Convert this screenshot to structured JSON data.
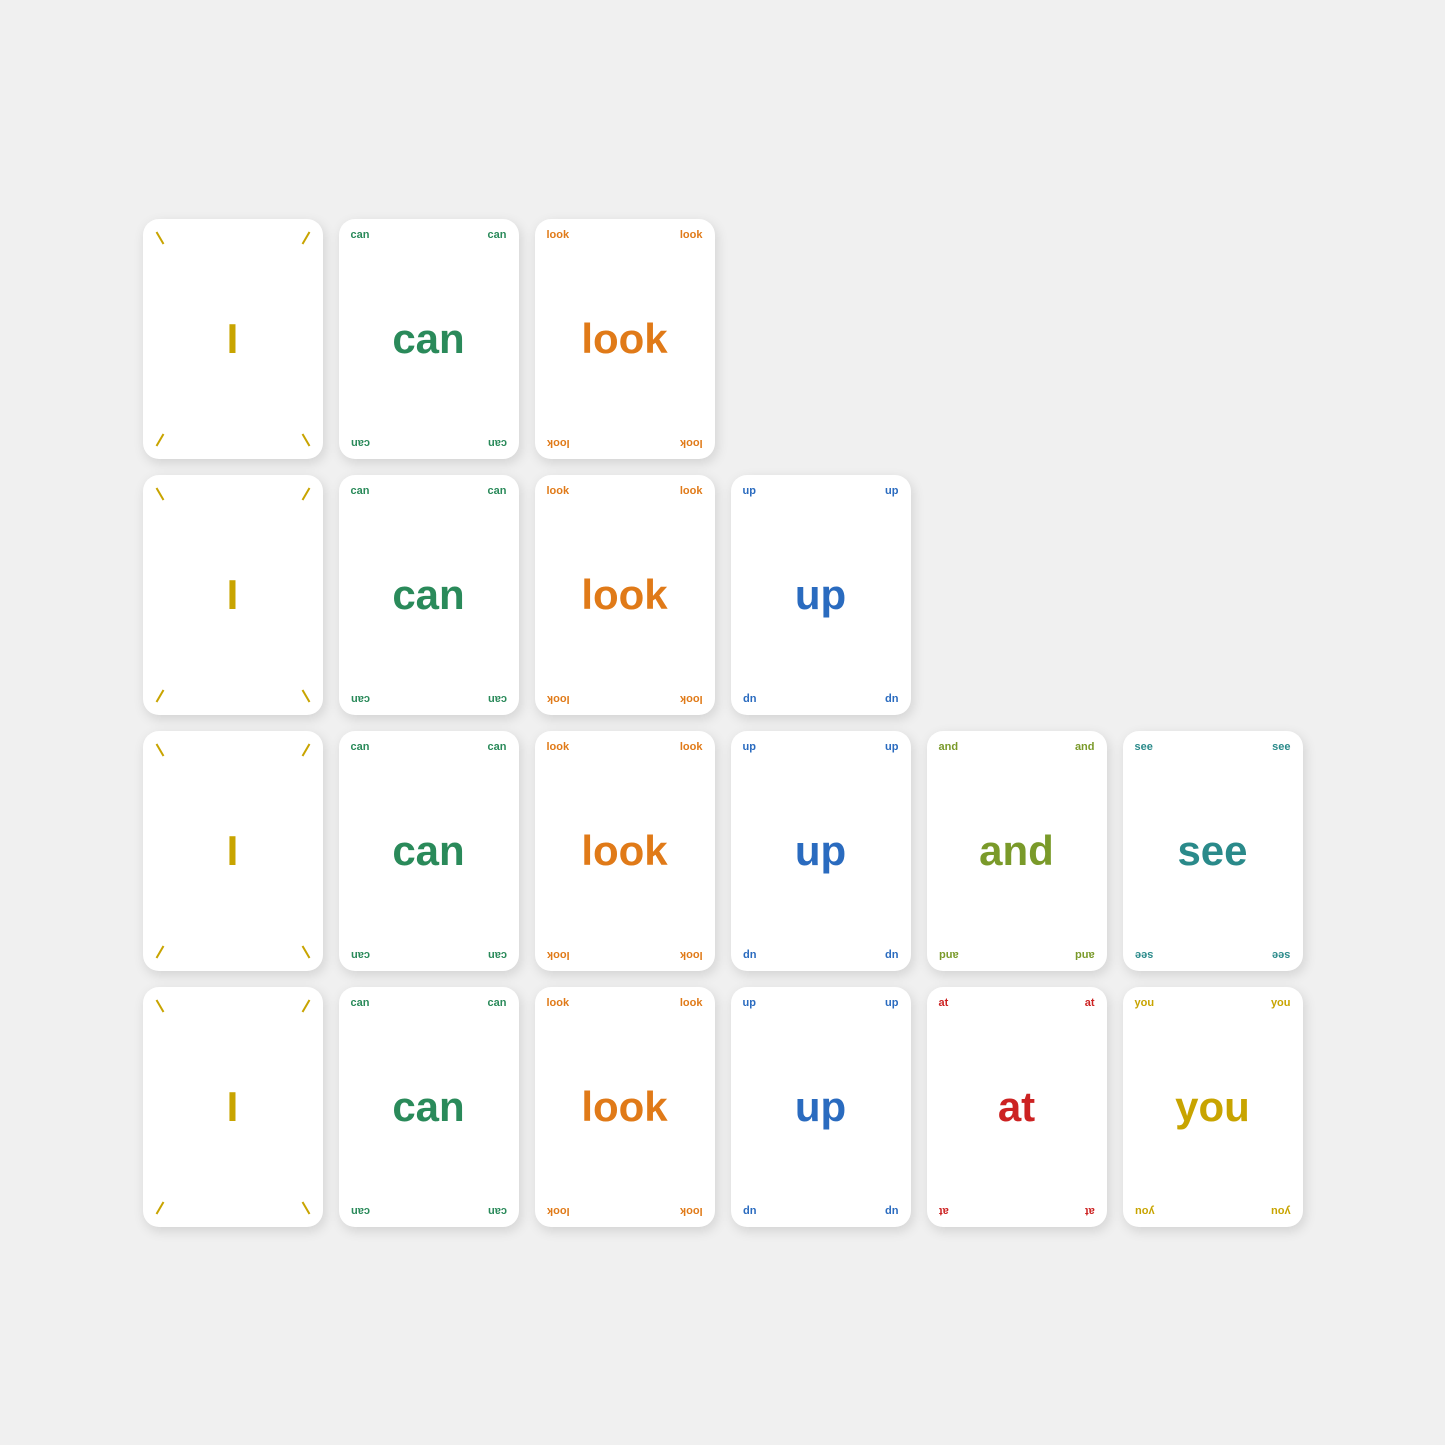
{
  "cards": [
    {
      "id": "i-1",
      "word": "I",
      "cornerWord": null,
      "colorClass": "color-i",
      "isTick": true,
      "row": 1,
      "col": 1
    },
    {
      "id": "can-1",
      "word": "can",
      "cornerWord": "can",
      "colorClass": "color-can",
      "isTick": false,
      "row": 1,
      "col": 2
    },
    {
      "id": "look-1",
      "word": "look",
      "cornerWord": "look",
      "colorClass": "color-look",
      "isTick": false,
      "row": 1,
      "col": 3
    },
    {
      "id": "i-2",
      "word": "I",
      "cornerWord": null,
      "colorClass": "color-i",
      "isTick": true,
      "row": 2,
      "col": 1
    },
    {
      "id": "can-2",
      "word": "can",
      "cornerWord": "can",
      "colorClass": "color-can",
      "isTick": false,
      "row": 2,
      "col": 2
    },
    {
      "id": "look-2",
      "word": "look",
      "cornerWord": "look",
      "colorClass": "color-look",
      "isTick": false,
      "row": 2,
      "col": 3
    },
    {
      "id": "up-1",
      "word": "up",
      "cornerWord": "up",
      "colorClass": "color-up",
      "isTick": false,
      "row": 2,
      "col": 4
    },
    {
      "id": "i-3",
      "word": "I",
      "cornerWord": null,
      "colorClass": "color-i",
      "isTick": true,
      "row": 3,
      "col": 1
    },
    {
      "id": "can-3",
      "word": "can",
      "cornerWord": "can",
      "colorClass": "color-can",
      "isTick": false,
      "row": 3,
      "col": 2
    },
    {
      "id": "look-3",
      "word": "look",
      "cornerWord": "look",
      "colorClass": "color-look",
      "isTick": false,
      "row": 3,
      "col": 3
    },
    {
      "id": "up-2",
      "word": "up",
      "cornerWord": "up",
      "colorClass": "color-up",
      "isTick": false,
      "row": 3,
      "col": 4
    },
    {
      "id": "and-1",
      "word": "and",
      "cornerWord": "and",
      "colorClass": "color-and",
      "isTick": false,
      "row": 3,
      "col": 5
    },
    {
      "id": "see-1",
      "word": "see",
      "cornerWord": "see",
      "colorClass": "color-see",
      "isTick": false,
      "row": 3,
      "col": 6
    },
    {
      "id": "i-4",
      "word": "I",
      "cornerWord": null,
      "colorClass": "color-i",
      "isTick": true,
      "row": 4,
      "col": 1
    },
    {
      "id": "can-4",
      "word": "can",
      "cornerWord": "can",
      "colorClass": "color-can",
      "isTick": false,
      "row": 4,
      "col": 2
    },
    {
      "id": "look-4",
      "word": "look",
      "cornerWord": "look",
      "colorClass": "color-look",
      "isTick": false,
      "row": 4,
      "col": 3
    },
    {
      "id": "up-3",
      "word": "up",
      "cornerWord": "up",
      "colorClass": "color-up",
      "isTick": false,
      "row": 4,
      "col": 4
    },
    {
      "id": "at-1",
      "word": "at",
      "cornerWord": "at",
      "colorClass": "color-at",
      "isTick": false,
      "row": 4,
      "col": 5
    },
    {
      "id": "you-1",
      "word": "you",
      "cornerWord": "you",
      "colorClass": "color-you",
      "isTick": false,
      "row": 4,
      "col": 6
    }
  ]
}
